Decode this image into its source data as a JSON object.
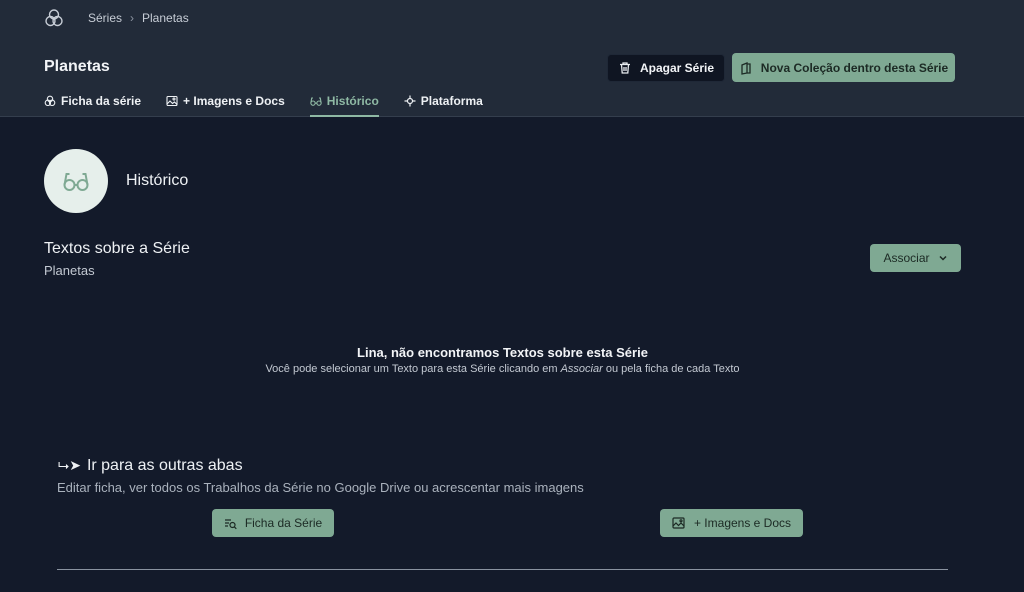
{
  "breadcrumb": {
    "logo_icon": "circles-logo-icon",
    "items": [
      "Séries",
      "Planetas"
    ],
    "separator": "›"
  },
  "header": {
    "title": "Planetas",
    "delete_button": {
      "label": "Apagar Série",
      "icon": "trash-icon"
    },
    "new_collection_button": {
      "label": "Nova Coleção dentro desta Série",
      "icon": "collection-icon"
    }
  },
  "tabs": [
    {
      "label": "Ficha da série",
      "icon": "circles-icon",
      "active": false
    },
    {
      "label": "+ Imagens e Docs",
      "icon": "image-icon",
      "active": true
    },
    {
      "label": "Histórico",
      "icon": "glasses-icon",
      "active": true
    },
    {
      "label": "Plataforma",
      "icon": "crosshair-icon",
      "active": false
    }
  ],
  "section": {
    "title": "Histórico",
    "icon": "glasses-icon"
  },
  "texts": {
    "title": "Textos sobre a Série",
    "subtitle": "Planetas",
    "associate_button": "Associar"
  },
  "empty_state": {
    "title": "Lina, não encontramos Textos sobre esta Série",
    "desc_before": "Você pode selecionar um Texto para esta Série clicando em ",
    "desc_em": "Associar",
    "desc_after": " ou pela ficha de cada Texto"
  },
  "goto": {
    "arrow": "⮡➤",
    "title": "Ir para as outras abas",
    "desc": "Editar ficha, ver todos os Trabalhos da Série no Google Drive ou acrescentar mais imagens",
    "ficha_button": "Ficha da Série",
    "imagens_button": "+ Imagens e Docs"
  },
  "colors": {
    "background": "#131a2a",
    "header": "#222b39",
    "accent_green": "#7fa993",
    "dark_button": "#0f1522"
  }
}
